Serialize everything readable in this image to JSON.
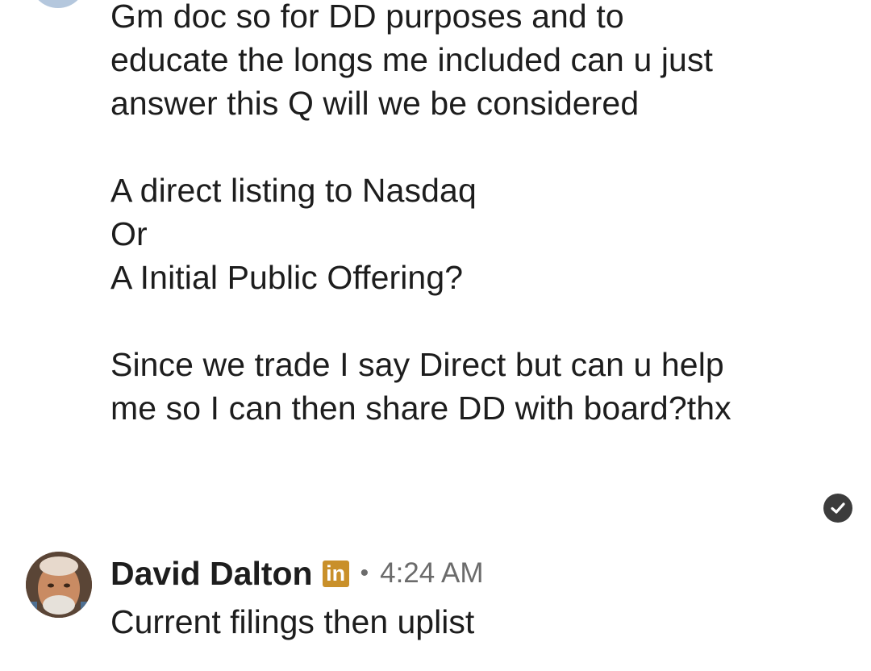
{
  "message": {
    "lines": [
      "Gm doc so for DD purposes and to",
      "educate the longs me included can u just",
      "answer this Q will we be considered",
      "",
      "A direct listing to Nasdaq",
      "Or",
      "A Initial Public Offering?",
      "",
      "Since we trade I say Direct but can u help",
      "me so I can then share DD with board?thx"
    ]
  },
  "reply": {
    "author": "David Dalton",
    "badge": "in",
    "separator": "•",
    "time": "4:24 AM",
    "text": "Current filings then uplist"
  },
  "icons": {
    "check": "check-circle-icon",
    "linkedin": "linkedin-icon"
  },
  "colors": {
    "text": "#1d1d1d",
    "muted": "#6b6b6b",
    "linkedin_badge": "#c9902a",
    "check_badge": "#3c3c3c"
  }
}
